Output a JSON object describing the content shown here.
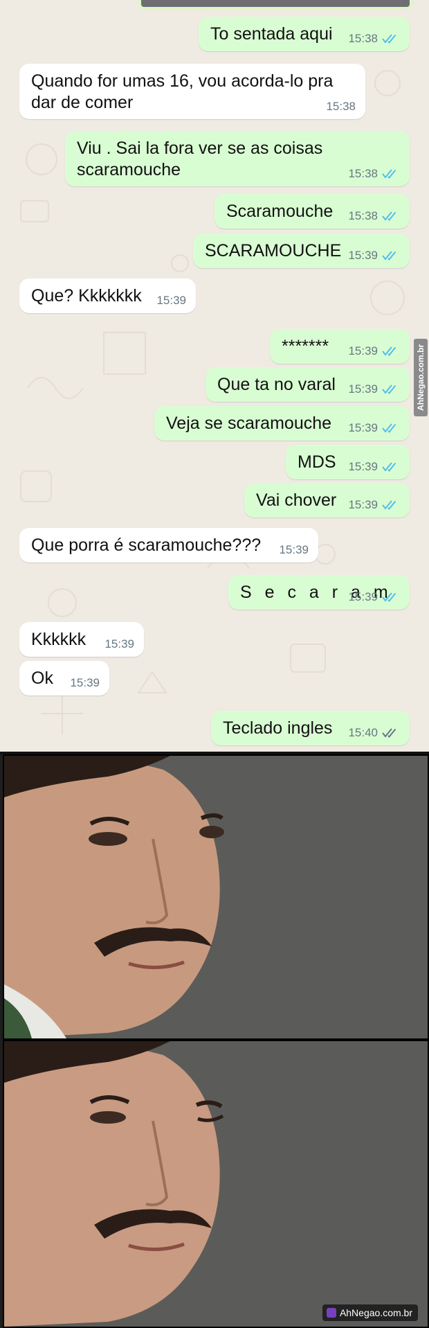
{
  "colors": {
    "outgoing_bubble": "#d9fdd3",
    "incoming_bubble": "#ffffff",
    "chat_background": "#efeae2",
    "read_ticks": "#53bdeb",
    "delivered_ticks": "#667781"
  },
  "messages": [
    {
      "text": "To sentada aqui",
      "time": "15:38",
      "status": "read"
    },
    {
      "text": "Quando for umas 16, vou acorda-lo pra dar de comer",
      "time": "15:38"
    },
    {
      "text": "Viu . Sai la fora ver se as coisas scaramouche",
      "time": "15:38",
      "status": "read"
    },
    {
      "text": "Scaramouche",
      "time": "15:38",
      "status": "read"
    },
    {
      "text": "SCARAMOUCHE",
      "time": "15:39",
      "status": "read"
    },
    {
      "text": "Que? Kkkkkkk",
      "time": "15:39"
    },
    {
      "text": "*******",
      "time": "15:39",
      "status": "read"
    },
    {
      "text": "Que ta no varal",
      "time": "15:39",
      "status": "read"
    },
    {
      "text": "Veja se scaramouche",
      "time": "15:39",
      "status": "read"
    },
    {
      "text": "MDS",
      "time": "15:39",
      "status": "read"
    },
    {
      "text": "Vai chover",
      "time": "15:39",
      "status": "read"
    },
    {
      "text": "Que porra é scaramouche???",
      "time": "15:39"
    },
    {
      "text": "S e c a r a m",
      "time": "15:39",
      "status": "read"
    },
    {
      "text": "Kkkkkk",
      "time": "15:39"
    },
    {
      "text": "Ok",
      "time": "15:39"
    },
    {
      "text": "Teclado ingles",
      "time": "15:40",
      "status": "delivered"
    }
  ],
  "watermark": {
    "side_text": "AhNegao.com.br",
    "badge_text": "AhNegao.com.br"
  },
  "meme_panels": [
    {
      "icon": "man-with-mustache-smirking"
    },
    {
      "icon": "man-with-mustache-winking"
    }
  ]
}
